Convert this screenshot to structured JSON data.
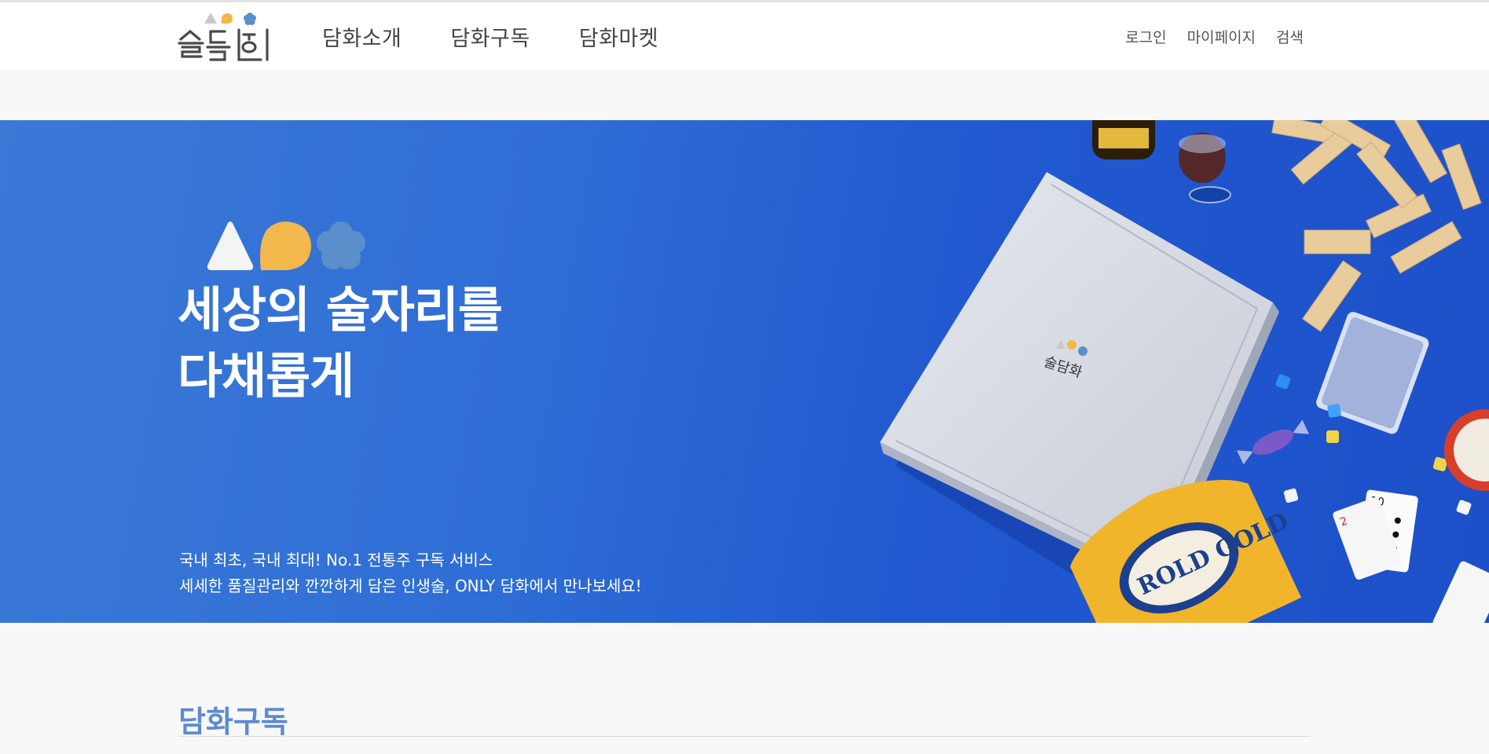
{
  "brand": {
    "logo_text": "술담화",
    "colors": {
      "triangle": "#c9c9c9",
      "drop": "#f2b84b",
      "flower": "#5b8fcb"
    }
  },
  "nav": {
    "main": [
      {
        "label": "담화소개"
      },
      {
        "label": "담화구독"
      },
      {
        "label": "담화마켓"
      }
    ],
    "utility": [
      {
        "label": "로그인"
      },
      {
        "label": "마이페이지"
      },
      {
        "label": "검색"
      }
    ]
  },
  "hero": {
    "title_line1": "세상의 술자리를",
    "title_line2": "다채롭게",
    "subtitle_line1": "국내 최초, 국내 최대! No.1 전통주 구독 서비스",
    "subtitle_line2": "세세한 품질관리와 깐깐하게 담은 인생술, ONLY 담화에서 만나보세요!",
    "background_color": "#2f6ed6",
    "box_logo_text": "술담화",
    "snack_bag_text": "ROLD GOLD"
  },
  "section": {
    "title": "담화구독"
  }
}
